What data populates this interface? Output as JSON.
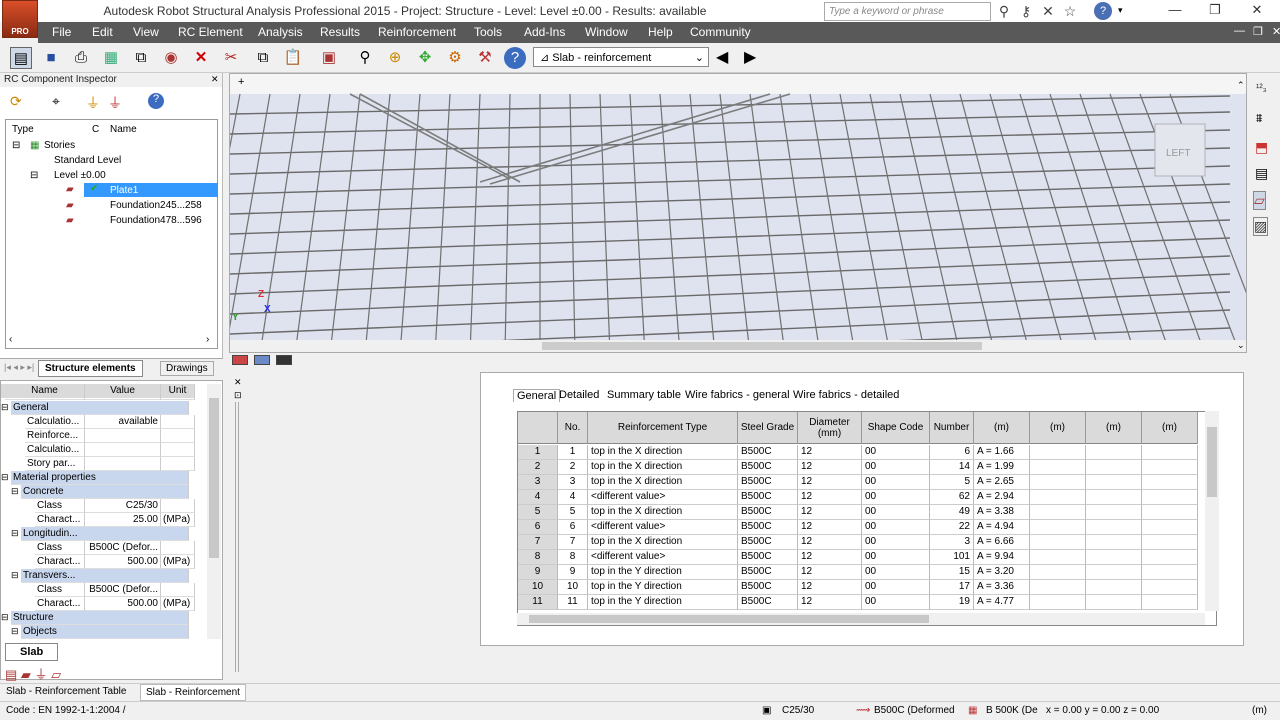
{
  "window": {
    "title": "Autodesk Robot Structural Analysis Professional 2015 - Project: Structure - Level: Level ±0.00 - Results: available",
    "logo_text": "PRO",
    "search_placeholder": "Type a keyword or phrase"
  },
  "menu": [
    "File",
    "Edit",
    "View",
    "RC Element",
    "Analysis",
    "Results",
    "Reinforcement",
    "Tools",
    "Add-Ins",
    "Window",
    "Help",
    "Community"
  ],
  "toolbar": {
    "view_combo": "Slab - reinforcement"
  },
  "inspector": {
    "title": "RC Component Inspector",
    "columns": [
      "Type",
      "C",
      "Name"
    ],
    "tree": [
      {
        "label": "Stories"
      },
      {
        "label": "Standard Level"
      },
      {
        "label": "Level ±0.00"
      },
      {
        "label": "Plate1",
        "selected": true
      },
      {
        "label": "Foundation245...258"
      },
      {
        "label": "Foundation478...596"
      }
    ],
    "tabs": [
      "Structure elements",
      "Drawings"
    ]
  },
  "viewport": {
    "tab_plus": "+",
    "viewcube_label": "LEFT",
    "axis_z": "Z",
    "axis_y": "Y",
    "axis_x": "X"
  },
  "properties": {
    "headers": [
      "Name",
      "Value",
      "Unit"
    ],
    "rows": [
      {
        "name": "General",
        "value": "",
        "unit": "",
        "section": true,
        "level": 0
      },
      {
        "name": "Calculatio...",
        "value": "available",
        "unit": "",
        "level": 1
      },
      {
        "name": "Reinforce...",
        "value": "",
        "unit": "",
        "level": 1
      },
      {
        "name": "Calculatio...",
        "value": "",
        "unit": "",
        "level": 1
      },
      {
        "name": "Story par...",
        "value": "",
        "unit": "",
        "level": 1
      },
      {
        "name": "Material properties",
        "value": "",
        "unit": "",
        "section": true,
        "level": 0
      },
      {
        "name": "Concrete",
        "value": "",
        "unit": "",
        "section": true,
        "level": 1
      },
      {
        "name": "Class",
        "value": "C25/30",
        "unit": "",
        "level": 2
      },
      {
        "name": "Charact...",
        "value": "25.00",
        "unit": "(MPa)",
        "level": 2
      },
      {
        "name": "Longitudin...",
        "value": "",
        "unit": "",
        "section": true,
        "level": 1
      },
      {
        "name": "Class",
        "value": "B500C (Defor...",
        "unit": "",
        "level": 2
      },
      {
        "name": "Charact...",
        "value": "500.00",
        "unit": "(MPa)",
        "level": 2
      },
      {
        "name": "Transvers...",
        "value": "",
        "unit": "",
        "section": true,
        "level": 1
      },
      {
        "name": "Class",
        "value": "B500C (Defor...",
        "unit": "",
        "level": 2
      },
      {
        "name": "Charact...",
        "value": "500.00",
        "unit": "(MPa)",
        "level": 2
      },
      {
        "name": "Structure",
        "value": "",
        "unit": "",
        "section": true,
        "level": 0
      },
      {
        "name": "Objects",
        "value": "",
        "unit": "",
        "section": true,
        "level": 1
      }
    ],
    "bottom_tab": "Slab"
  },
  "table": {
    "tabs": [
      "General",
      "Detailed",
      "Summary table",
      "Wire fabrics - general",
      "Wire fabrics - detailed"
    ],
    "headers": [
      "",
      "No.",
      "Reinforcement Type",
      "Steel Grade",
      "Diameter\n(mm)",
      "Shape Code",
      "Number",
      "(m)",
      "(m)",
      "(m)",
      "(m)"
    ],
    "rows": [
      [
        "1",
        "1",
        "top in the X direction",
        "B500C",
        "12",
        "00",
        "6",
        "A = 1.66"
      ],
      [
        "2",
        "2",
        "top in the X direction",
        "B500C",
        "12",
        "00",
        "14",
        "A = 1.99"
      ],
      [
        "3",
        "3",
        "top in the X direction",
        "B500C",
        "12",
        "00",
        "5",
        "A = 2.65"
      ],
      [
        "4",
        "4",
        "<different value>",
        "B500C",
        "12",
        "00",
        "62",
        "A = 2.94"
      ],
      [
        "5",
        "5",
        "top in the X direction",
        "B500C",
        "12",
        "00",
        "49",
        "A = 3.38"
      ],
      [
        "6",
        "6",
        "<different value>",
        "B500C",
        "12",
        "00",
        "22",
        "A = 4.94"
      ],
      [
        "7",
        "7",
        "top in the X direction",
        "B500C",
        "12",
        "00",
        "3",
        "A = 6.66"
      ],
      [
        "8",
        "8",
        "<different value>",
        "B500C",
        "12",
        "00",
        "101",
        "A = 9.94"
      ],
      [
        "9",
        "9",
        "top in the Y direction",
        "B500C",
        "12",
        "00",
        "15",
        "A = 3.20"
      ],
      [
        "10",
        "10",
        "top in the Y direction",
        "B500C",
        "12",
        "00",
        "17",
        "A = 3.36"
      ],
      [
        "11",
        "11",
        "top in the Y direction",
        "B500C",
        "12",
        "00",
        "19",
        "A = 4.77"
      ]
    ]
  },
  "status": {
    "tabs": [
      "Slab - Reinforcement Table",
      "Slab - Reinforcement"
    ],
    "code": "Code : EN 1992-1-1:2004 /",
    "concrete": "C25/30",
    "steel1": "B500C (Deformed",
    "steel2": "B 500K (De",
    "coords": "x = 0.00  y = 0.00  z = 0.00",
    "unit": "(m)"
  }
}
